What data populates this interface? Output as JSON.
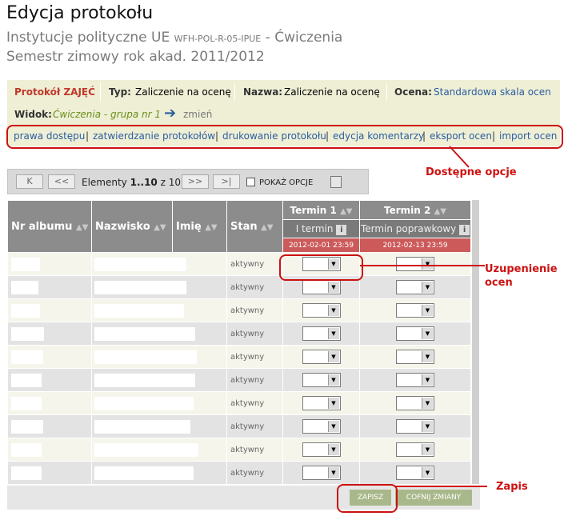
{
  "page": {
    "title": "Edycja protokołu",
    "course_name": "Instytucje polityczne UE",
    "course_code": "WFH-POL-R-05-IPUE",
    "course_type": "- Ćwiczenia",
    "semester": "Semestr zimowy rok akad. 2011/2012"
  },
  "info": {
    "protocol_label": "Protokół ZAJĘĆ",
    "typ_label": "Typ:",
    "typ_value": "Zaliczenie na ocenę",
    "nazwa_label": "Nazwa:",
    "nazwa_value": "Zaliczenie na ocenę",
    "ocena_label": "Ocena:",
    "ocena_value": "Standardowa skala ocen",
    "widok_label": "Widok:",
    "widok_value": "Ćwiczenia - grupa nr 1",
    "zmien": "zmień"
  },
  "options": {
    "items": [
      "prawa dostępu",
      "zatwierdzanie protokołów",
      "drukowanie protokołu",
      "edycja komentarzy",
      "eksport ocen",
      "import ocen"
    ],
    "separator": "|"
  },
  "pager": {
    "first": "K",
    "prev": "<<",
    "elements_prefix": "Elementy ",
    "elements_range": "1..10",
    "elements_suffix": " z 10",
    "next": ">>",
    "last": ">|",
    "show_options": "POKAŻ OPCJE"
  },
  "table": {
    "col_nr": "Nr albumu",
    "col_nazwisko": "Nazwisko",
    "col_imie": "Imię",
    "col_stan": "Stan",
    "term1": "Termin 1",
    "term2": "Termin 2",
    "term1_sub": "I termin",
    "term2_sub": "Termin poprawkowy",
    "term1_date": "2012-02-01 23:59",
    "term2_date": "2012-02-13 23:59",
    "sort_arrows": "▲▼",
    "rows": [
      {
        "stan": "aktywny"
      },
      {
        "stan": "aktywny"
      },
      {
        "stan": "aktywny"
      },
      {
        "stan": "aktywny"
      },
      {
        "stan": "aktywny"
      },
      {
        "stan": "aktywny"
      },
      {
        "stan": "aktywny"
      },
      {
        "stan": "aktywny"
      },
      {
        "stan": "aktywny"
      },
      {
        "stan": "aktywny"
      }
    ]
  },
  "buttons": {
    "save": "ZAPISZ",
    "revert": "COFNIJ ZMIANY"
  },
  "annotations": {
    "options": "Dostępne opcje",
    "grades_line1": "Uzupenienie",
    "grades_line2": "ocen",
    "save": "Zapis"
  },
  "colors": {
    "annotation": "#cc1111",
    "header": "#8c8c8c",
    "date_bar": "#cc5a5a",
    "info_bg": "#efefd6",
    "link": "#2a5d9f"
  }
}
